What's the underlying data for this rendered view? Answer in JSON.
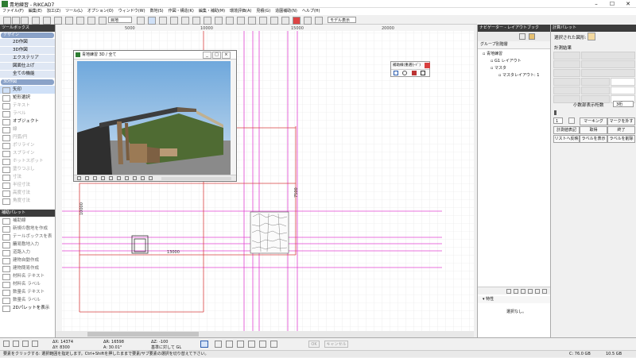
{
  "app": {
    "title": "青地練習 - RIKCAD7"
  },
  "menu": [
    "ファイル(F)",
    "編集(E)",
    "加工(Z)",
    "ツール(L)",
    "オプション(O)",
    "ウィンドウ(W)",
    "数地(S)",
    "作図・構造(K)",
    "編集・補助(M)",
    "環境評価(A)",
    "見積(G)",
    "造園補助(N)",
    "ヘルプ(H)"
  ],
  "toolbar": {
    "layer_label": "目地",
    "model_label": "モデル表示"
  },
  "left_panel": {
    "title": "ツールボックス",
    "section_design": "デザイン",
    "modes": [
      "2D作図",
      "3D作図",
      "エクステリア",
      "図面仕上げ",
      "全ての機能"
    ],
    "section_tools": "3D作図",
    "tools": [
      {
        "label": "矢印",
        "state": "sel"
      },
      {
        "label": "矩形選択",
        "state": "on"
      },
      {
        "label": "テキスト",
        "state": "dis"
      },
      {
        "label": "ラベル",
        "state": "dis"
      },
      {
        "label": "オブジェクト",
        "state": "on"
      },
      {
        "label": "線",
        "state": "dis"
      },
      {
        "label": "円弧/円",
        "state": "dis"
      },
      {
        "label": "ポリライン",
        "state": "dis"
      },
      {
        "label": "スプライン",
        "state": "dis"
      },
      {
        "label": "ホットスポット",
        "state": "dis"
      },
      {
        "label": "塗りつぶし",
        "state": "dis"
      },
      {
        "label": "寸法",
        "state": "dis"
      },
      {
        "label": "半径寸法",
        "state": "dis"
      },
      {
        "label": "高度寸法",
        "state": "dis"
      },
      {
        "label": "角度寸法",
        "state": "dis"
      }
    ],
    "palette_title": "補助パレット",
    "palette_items": [
      "補助線",
      "新規の敷地を作成",
      "テールボックスを表示",
      "簡易敷地入力",
      "道路入力",
      "建物自動作成",
      "建物簡易作成",
      "材料名 テキスト",
      "材料名 ラベル",
      "数量名 テキスト",
      "数量名 ラベル"
    ],
    "palette_button": "2Dパレットを表示"
  },
  "canvas": {
    "ruler_labels": [
      "5000",
      "10000",
      "15000",
      "20000"
    ],
    "dim_top": "13000",
    "dim_left": "10000",
    "dim_right": "7500"
  },
  "win3d": {
    "title": "青地練習 3D / 全て"
  },
  "aux_palette": {
    "title": "補助線(重選ﾓｰﾄﾞ)"
  },
  "nav_panel": {
    "title": "ナビゲーター - レイアウトブック",
    "tab": "グループ別階層",
    "tree": [
      {
        "label": "青地練習",
        "indent": 0
      },
      {
        "label": "G1 レイアウト",
        "indent": 1
      },
      {
        "label": "マスタ",
        "indent": 1
      },
      {
        "label": "マスタレイアウト: 1",
        "indent": 2
      }
    ],
    "props_title": "特性",
    "props_value": "選択なし。"
  },
  "calc_panel": {
    "title": "計算パレット",
    "selected_label": "選択された図形:",
    "result_label": "計測結果",
    "digits_label": "小数部表示桁数",
    "digits_value": "3桁",
    "stepper_value": "1",
    "buttons": [
      "マーキング",
      "マークを外す",
      "計測値表記",
      "取得",
      "終了",
      "リストへ反映",
      "ラベルを表示",
      "ラベルを削除"
    ]
  },
  "bottom": {
    "dx_label": "ΔX: 14374",
    "dy_label": "ΔY: 8300",
    "ar_label": "ΔR: 16598",
    "a_label": "A: 30.01°",
    "az_label": "ΔZ: -100",
    "gl_label": "基準に対して GL",
    "ok": "OK",
    "cancel": "キャンセル"
  },
  "status": {
    "message": "要素をクリックする: 選択範囲を指定します。Ctrl+Shiftを押したままで要素/サブ要素の選択を切り替えて下さい。",
    "disk": "C: 76.0 GB",
    "mem": "10.5 GB"
  },
  "colors": {
    "magenta": "#e040d0",
    "red": "#d84040",
    "accent": "#8aa2c8"
  }
}
